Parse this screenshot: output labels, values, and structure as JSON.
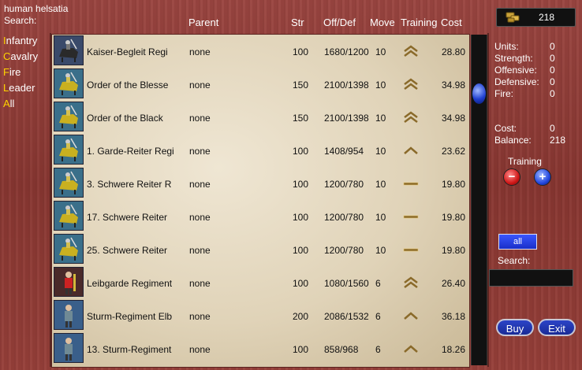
{
  "header": {
    "faction": "human helsatia",
    "search_label": "Search:",
    "columns": {
      "parent": "Parent",
      "str": "Str",
      "offdef": "Off/Def",
      "move": "Move",
      "training": "Training",
      "cost": "Cost"
    },
    "gold": "218"
  },
  "filters": [
    {
      "hot": "I",
      "rest": "nfantry"
    },
    {
      "hot": "C",
      "rest": "avalry"
    },
    {
      "hot": "F",
      "rest": "ire"
    },
    {
      "hot": "L",
      "rest": "eader"
    },
    {
      "hot": "A",
      "rest": "ll"
    }
  ],
  "units": [
    {
      "name": "Kaiser-Begleit Regi",
      "parent": "none",
      "str": "100",
      "offdef": "1680/1200",
      "move": "10",
      "training": "double",
      "cost": "28.80",
      "portrait": "cavalry-dark"
    },
    {
      "name": "Order of the Blesse",
      "parent": "none",
      "str": "150",
      "offdef": "2100/1398",
      "move": "10",
      "training": "double",
      "cost": "34.98",
      "portrait": "cavalry"
    },
    {
      "name": "Order of the Black",
      "parent": "none",
      "str": "150",
      "offdef": "2100/1398",
      "move": "10",
      "training": "double",
      "cost": "34.98",
      "portrait": "cavalry"
    },
    {
      "name": "1. Garde-Reiter Regi",
      "parent": "none",
      "str": "100",
      "offdef": "1408/954",
      "move": "10",
      "training": "single",
      "cost": "23.62",
      "portrait": "cavalry"
    },
    {
      "name": "3. Schwere Reiter R",
      "parent": "none",
      "str": "100",
      "offdef": "1200/780",
      "move": "10",
      "training": "bar",
      "cost": "19.80",
      "portrait": "cavalry"
    },
    {
      "name": "17. Schwere Reiter",
      "parent": "none",
      "str": "100",
      "offdef": "1200/780",
      "move": "10",
      "training": "bar",
      "cost": "19.80",
      "portrait": "cavalry"
    },
    {
      "name": "25. Schwere Reiter",
      "parent": "none",
      "str": "100",
      "offdef": "1200/780",
      "move": "10",
      "training": "bar",
      "cost": "19.80",
      "portrait": "cavalry"
    },
    {
      "name": "Leibgarde Regiment",
      "parent": "none",
      "str": "100",
      "offdef": "1080/1560",
      "move": "6",
      "training": "double",
      "cost": "26.40",
      "portrait": "infantry-red"
    },
    {
      "name": "Sturm-Regiment Elb",
      "parent": "none",
      "str": "200",
      "offdef": "2086/1532",
      "move": "6",
      "training": "single",
      "cost": "36.18",
      "portrait": "infantry"
    },
    {
      "name": "13. Sturm-Regiment",
      "parent": "none",
      "str": "100",
      "offdef": "858/968",
      "move": "6",
      "training": "single",
      "cost": "18.26",
      "portrait": "infantry"
    }
  ],
  "stats": {
    "units_label": "Units:",
    "units": "0",
    "strength_label": "Strength:",
    "strength": "0",
    "offensive_label": "Offensive:",
    "offensive": "0",
    "defensive_label": "Defensive:",
    "defensive": "0",
    "fire_label": "Fire:",
    "fire": "0",
    "cost_label": "Cost:",
    "cost": "0",
    "balance_label": "Balance:",
    "balance": "218"
  },
  "controls": {
    "training_label": "Training",
    "all_label": "all",
    "search_label": "Search:",
    "buy_label": "Buy",
    "exit_label": "Exit"
  },
  "colors": {
    "panel": "#8e3b34",
    "parchment": "#e6dcc6",
    "highlight": "#ffd400",
    "button_blue": "#1a2fc8"
  }
}
